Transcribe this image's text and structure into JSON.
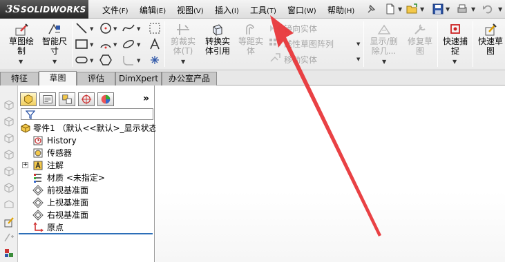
{
  "app": {
    "logo_mark": "3S",
    "logo_text": "SOLIDWORKS"
  },
  "menu": [
    {
      "label": "文件",
      "key": "(F)"
    },
    {
      "label": "编辑",
      "key": "(E)"
    },
    {
      "label": "视图",
      "key": "(V)"
    },
    {
      "label": "插入",
      "key": "(I)"
    },
    {
      "label": "工具",
      "key": "(T)"
    },
    {
      "label": "窗口",
      "key": "(W)"
    },
    {
      "label": "帮助",
      "key": "(H)"
    }
  ],
  "quick_access": [
    "pin-icon",
    "new-document-icon",
    "open-folder-icon",
    "save-icon",
    "print-icon",
    "undo-icon"
  ],
  "toolbar": {
    "sketch": "草图绘\n制",
    "smart_dimension": "智能尺\n寸",
    "trim": "剪裁实\n体(T)",
    "convert": "转换实\n体引用",
    "offset": "等距实\n体",
    "mirror": "镜向实体",
    "linear_pattern": "线性草图阵列",
    "move": "移动实体",
    "show_delete": "显示/删\n除几...",
    "repair": "修复草\n图",
    "quick_snap": "快速捕\n捉",
    "rapid_sketch": "快速草\n图"
  },
  "tabs": [
    "特征",
    "草图",
    "评估",
    "DimXpert",
    "办公室产品"
  ],
  "active_tab": "草图",
  "feature_tree": {
    "root": "零件1 （默认<<默认>_显示状态",
    "items": [
      {
        "label": "History",
        "icon": "history-icon"
      },
      {
        "label": "传感器",
        "icon": "sensor-icon"
      },
      {
        "label": "注解",
        "icon": "annotation-icon"
      },
      {
        "label": "材质 <未指定>",
        "icon": "material-icon"
      },
      {
        "label": "前视基准面",
        "icon": "plane-icon"
      },
      {
        "label": "上视基准面",
        "icon": "plane-icon"
      },
      {
        "label": "右视基准面",
        "icon": "plane-icon"
      },
      {
        "label": "原点",
        "icon": "origin-icon"
      }
    ]
  },
  "colors": {
    "annotation_arrow": "#e8373a",
    "selection_blue": "#2d6fb8"
  }
}
